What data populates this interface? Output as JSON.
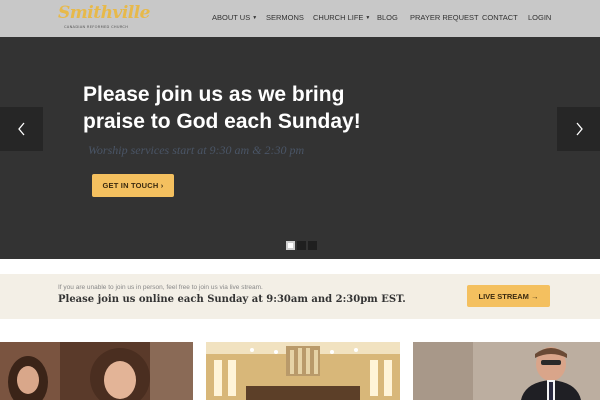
{
  "logo": {
    "script_text": "Smithville",
    "sub_text": "CANADIAN REFORMED CHURCH"
  },
  "nav": {
    "items": [
      {
        "label": "ABOUT US",
        "has_dropdown": true
      },
      {
        "label": "SERMONS",
        "has_dropdown": false
      },
      {
        "label": "CHURCH LIFE",
        "has_dropdown": true
      },
      {
        "label": "BLOG",
        "has_dropdown": false
      },
      {
        "label": "PRAYER REQUEST",
        "has_dropdown": false
      },
      {
        "label": "CONTACT",
        "has_dropdown": false
      },
      {
        "label": "LOGIN",
        "has_dropdown": false
      }
    ]
  },
  "hero": {
    "title": "Please join us as we bring praise to God each Sunday!",
    "subtitle": "Worship services start at 9:30 am & 2:30 pm",
    "cta_label": "GET IN TOUCH ›",
    "slide_count": 3,
    "active_slide": 1
  },
  "livestream": {
    "intro": "If you are unable to join us in person, feel free to join us via live stream.",
    "message": "Please join us online each Sunday at 9:30am and 2:30pm EST.",
    "button_label": "LIVE STREAM →"
  },
  "colors": {
    "header_bg": "#c8c8c8",
    "hero_bg": "#333333",
    "accent": "#f4c05f",
    "band_bg": "#f3efe6"
  }
}
